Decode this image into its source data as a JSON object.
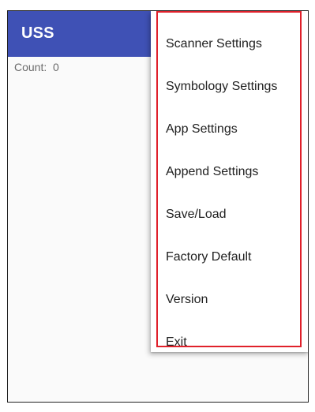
{
  "app_bar": {
    "title": "USS",
    "color": "#3f51b5"
  },
  "main": {
    "count_label": "Count:",
    "count_value": "0"
  },
  "overflow_menu": {
    "highlight_color": "#e0212b",
    "items": [
      {
        "label": "Scanner Settings"
      },
      {
        "label": "Symbology Settings"
      },
      {
        "label": "App Settings"
      },
      {
        "label": "Append Settings"
      },
      {
        "label": "Save/Load"
      },
      {
        "label": "Factory Default"
      },
      {
        "label": "Version"
      },
      {
        "label": "Exit"
      }
    ]
  }
}
